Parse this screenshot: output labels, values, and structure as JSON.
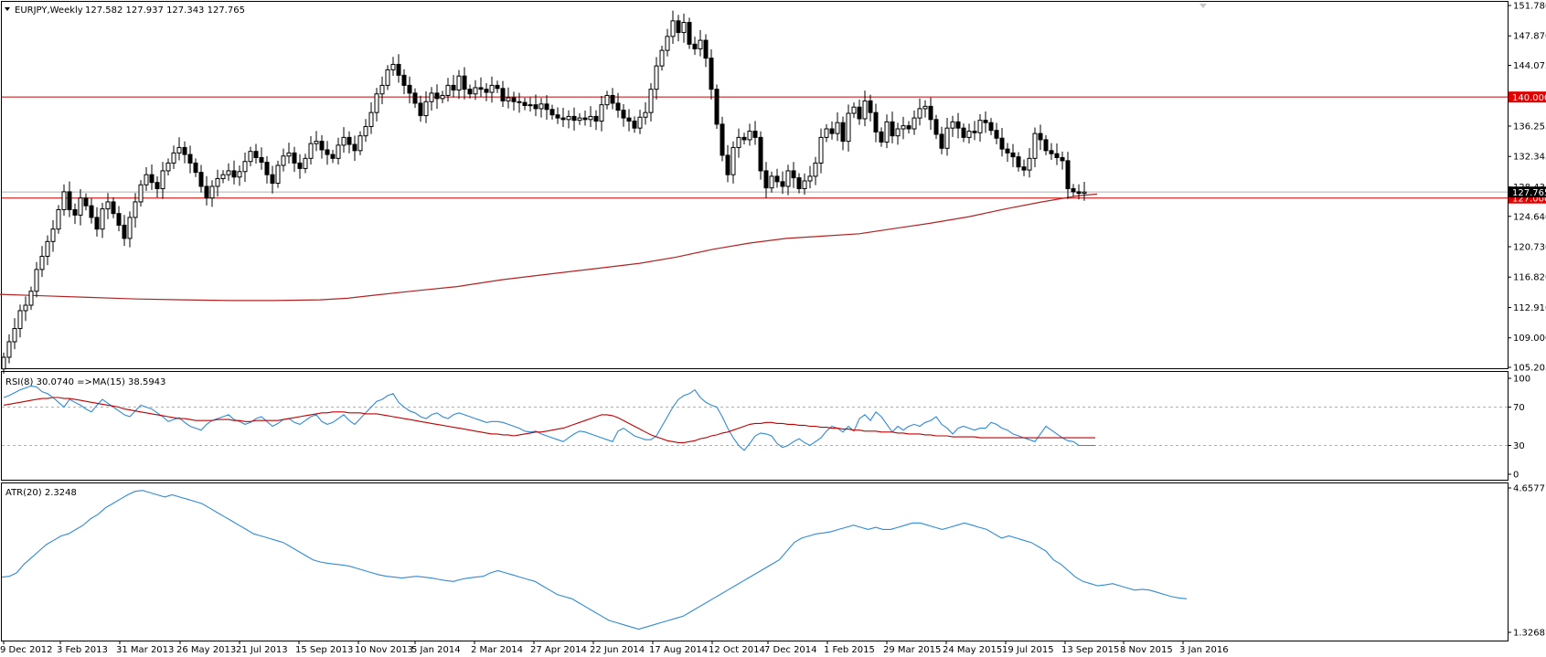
{
  "header": {
    "symbol": "EURJPY,Weekly",
    "ohlc": "127.582 127.937 127.343 127.765",
    "rsi_label": "RSI(8) 30.0740  =>MA(15) 38.5943",
    "atr_label": "ATR(20) 2.3248"
  },
  "colors": {
    "candle_up": "#ffffff",
    "candle_down": "#000000",
    "hline": "#cc0000",
    "ma": "#b22222",
    "rsi": "#2f8ad8",
    "rsi_ma": "#c00000",
    "atr": "#2f8ad8",
    "tag_bg": "#e00000",
    "grid": "#b0b0b0"
  },
  "chart_data": [
    {
      "type": "candlestick",
      "title": "EURJPY,Weekly",
      "x_labels": [
        "9 Dec 2012",
        "3 Feb 2013",
        "31 Mar 2013",
        "26 May 2013",
        "21 Jul 2013",
        "15 Sep 2013",
        "10 Nov 2013",
        "5 Jan 2014",
        "2 Mar 2014",
        "27 Apr 2014",
        "22 Jun 2014",
        "17 Aug 2014",
        "12 Oct 2014",
        "7 Dec 2014",
        "1 Feb 2015",
        "29 Mar 2015",
        "24 May 2015",
        "19 Jul 2015",
        "13 Sep 2015",
        "8 Nov 2015",
        "3 Jan 2016"
      ],
      "y_ticks": [
        "151.780",
        "147.870",
        "144.075",
        "140.000",
        "136.255",
        "132.345",
        "128.435",
        "124.640",
        "120.730",
        "116.820",
        "112.910",
        "109.000",
        "105.205"
      ],
      "ylim": [
        105.205,
        151.78
      ],
      "price_tag": "127.765",
      "horizontal_lines": [
        {
          "value": 140.0,
          "label": "140.000"
        },
        {
          "value": 127.0,
          "label": "127.000"
        }
      ],
      "closes": [
        106.5,
        108.5,
        110.2,
        112.5,
        113.2,
        115.0,
        117.8,
        119.5,
        121.4,
        123.0,
        125.5,
        127.8,
        125.5,
        124.8,
        127.0,
        126.0,
        124.5,
        123.0,
        125.6,
        126.5,
        125.0,
        123.5,
        121.8,
        124.5,
        126.5,
        128.7,
        130.0,
        129.0,
        128.2,
        130.5,
        131.5,
        132.8,
        133.5,
        132.6,
        131.5,
        130.3,
        128.5,
        127.0,
        128.5,
        129.5,
        130.0,
        130.5,
        129.7,
        130.4,
        131.7,
        133.0,
        132.2,
        131.6,
        130.0,
        128.9,
        131.2,
        132.4,
        132.8,
        131.5,
        130.8,
        132.1,
        134.0,
        134.3,
        133.2,
        132.6,
        132.1,
        133.8,
        134.8,
        133.9,
        133.1,
        135.0,
        136.2,
        138.0,
        140.4,
        141.5,
        143.5,
        144.2,
        142.8,
        141.5,
        140.5,
        139.2,
        137.6,
        139.4,
        140.5,
        139.8,
        140.2,
        141.5,
        140.9,
        142.7,
        141.0,
        140.4,
        141.2,
        141.0,
        140.6,
        141.5,
        141.1,
        139.5,
        139.9,
        139.4,
        139.3,
        138.9,
        139.0,
        138.5,
        139.1,
        138.4,
        137.7,
        137.3,
        137.1,
        137.5,
        137.0,
        137.3,
        137.1,
        137.5,
        136.9,
        139.0,
        140.2,
        139.2,
        138.3,
        137.3,
        136.9,
        136.0,
        137.4,
        138.0,
        141.0,
        144.0,
        146.0,
        147.8,
        149.8,
        148.3,
        149.6,
        146.8,
        146.2,
        147.3,
        145.0,
        141.0,
        136.5,
        132.5,
        130.0,
        133.5,
        134.8,
        134.5,
        135.6,
        134.8,
        130.5,
        128.3,
        129.8,
        129.1,
        128.5,
        130.5,
        129.6,
        128.2,
        129.2,
        129.8,
        131.5,
        134.8,
        135.9,
        135.3,
        136.7,
        134.3,
        137.9,
        138.7,
        137.2,
        139.5,
        138.0,
        135.5,
        134.2,
        136.8,
        135.0,
        135.9,
        136.3,
        135.9,
        137.3,
        138.5,
        138.8,
        137.1,
        135.2,
        133.4,
        136.0,
        136.8,
        136.0,
        134.8,
        135.6,
        135.4,
        137.0,
        136.7,
        135.7,
        134.7,
        133.3,
        132.8,
        132.3,
        131.0,
        130.6,
        132.1,
        135.3,
        134.5,
        133.1,
        132.7,
        132.2,
        131.8,
        128.2,
        127.8,
        127.6,
        127.765
      ],
      "ma_line": [
        [
          0,
          114.6
        ],
        [
          50,
          114.4
        ],
        [
          100,
          114.2
        ],
        [
          150,
          114.0
        ],
        [
          200,
          113.9
        ],
        [
          250,
          113.8
        ],
        [
          300,
          113.8
        ],
        [
          350,
          113.9
        ],
        [
          380,
          114.1
        ],
        [
          410,
          114.5
        ],
        [
          450,
          115.0
        ],
        [
          500,
          115.6
        ],
        [
          550,
          116.5
        ],
        [
          600,
          117.2
        ],
        [
          650,
          117.9
        ],
        [
          700,
          118.6
        ],
        [
          740,
          119.4
        ],
        [
          780,
          120.4
        ],
        [
          820,
          121.2
        ],
        [
          860,
          121.8
        ],
        [
          900,
          122.1
        ],
        [
          940,
          122.4
        ],
        [
          980,
          123.1
        ],
        [
          1020,
          123.8
        ],
        [
          1060,
          124.6
        ],
        [
          1100,
          125.6
        ],
        [
          1140,
          126.5
        ],
        [
          1180,
          127.3
        ],
        [
          1200,
          127.5
        ]
      ],
      "x_unit": "pixel x offset of MA sample is layout; values listed only as price"
    },
    {
      "type": "line",
      "title": "RSI(8) 30.0740  =>MA(15) 38.5943",
      "y_ticks": [
        "100",
        "70",
        "30",
        "0"
      ],
      "ylim": [
        0,
        100
      ],
      "levels": [
        70,
        30
      ],
      "series": [
        {
          "name": "RSI(8)",
          "values": [
            80,
            82,
            85,
            88,
            90,
            92,
            91,
            86,
            84,
            80,
            75,
            70,
            78,
            75,
            72,
            68,
            65,
            72,
            78,
            74,
            70,
            66,
            62,
            60,
            66,
            72,
            70,
            68,
            64,
            60,
            55,
            57,
            59,
            54,
            50,
            48,
            46,
            52,
            56,
            58,
            60,
            62,
            57,
            55,
            52,
            54,
            58,
            60,
            55,
            50,
            53,
            57,
            58,
            54,
            52,
            56,
            60,
            62,
            55,
            52,
            54,
            58,
            62,
            56,
            52,
            58,
            64,
            70,
            76,
            78,
            82,
            84,
            75,
            70,
            66,
            64,
            60,
            58,
            62,
            64,
            60,
            58,
            62,
            64,
            62,
            60,
            58,
            56,
            54,
            55,
            55,
            54,
            52,
            50,
            48,
            45,
            44,
            45,
            42,
            40,
            38,
            36,
            34,
            38,
            42,
            45,
            44,
            42,
            40,
            38,
            36,
            34,
            45,
            48,
            44,
            40,
            38,
            36,
            36,
            40,
            50,
            60,
            70,
            78,
            82,
            84,
            88,
            80,
            75,
            72,
            70,
            60,
            48,
            38,
            30,
            25,
            32,
            40,
            43,
            42,
            40,
            32,
            28,
            30,
            34,
            37,
            33,
            30,
            34,
            38,
            45,
            50,
            48,
            44,
            50,
            45,
            58,
            62,
            56,
            65,
            60,
            52,
            44,
            50,
            46,
            50,
            52,
            50,
            54,
            56,
            60,
            52,
            48,
            42,
            48,
            50,
            48,
            46,
            48,
            48,
            54,
            52,
            48,
            46,
            42,
            40,
            38,
            36,
            34,
            42,
            50,
            46,
            42,
            38,
            35,
            34,
            30,
            30,
            30,
            30
          ]
        },
        {
          "name": "MA(15)",
          "values": [
            72,
            73,
            74,
            75,
            76,
            77,
            78,
            79,
            79,
            80,
            80,
            79,
            79,
            78,
            77,
            76,
            75,
            74,
            73,
            72,
            71,
            70,
            68,
            67,
            66,
            65,
            64,
            63,
            62,
            61,
            60,
            59,
            58,
            58,
            57,
            56,
            56,
            56,
            56,
            57,
            57,
            57,
            56,
            56,
            55,
            55,
            56,
            56,
            56,
            56,
            56,
            57,
            58,
            59,
            60,
            61,
            62,
            63,
            64,
            64,
            65,
            65,
            65,
            64,
            64,
            64,
            63,
            63,
            63,
            62,
            61,
            60,
            59,
            58,
            57,
            56,
            55,
            54,
            53,
            52,
            51,
            50,
            49,
            48,
            47,
            46,
            45,
            44,
            43,
            42,
            42,
            41,
            41,
            40,
            41,
            42,
            43,
            44,
            44,
            45,
            46,
            47,
            48,
            50,
            52,
            54,
            56,
            58,
            60,
            62,
            62,
            61,
            59,
            56,
            53,
            50,
            47,
            44,
            41,
            39,
            37,
            35,
            34,
            33,
            33,
            34,
            35,
            37,
            38,
            40,
            41,
            43,
            44,
            46,
            48,
            50,
            52,
            53,
            53,
            54,
            54,
            53,
            53,
            52,
            52,
            51,
            51,
            50,
            50,
            49,
            49,
            48,
            48,
            47,
            47,
            46,
            46,
            45,
            45,
            45,
            44,
            44,
            44,
            43,
            43,
            42,
            42,
            42,
            41,
            41,
            40,
            40,
            40,
            39,
            39,
            39,
            39,
            39,
            38,
            38,
            38,
            38,
            38,
            38,
            38,
            38,
            38,
            38,
            38,
            38,
            38,
            38,
            38,
            38,
            38,
            38,
            38,
            38,
            38,
            38
          ]
        }
      ]
    },
    {
      "type": "line",
      "title": "ATR(20) 2.3248",
      "y_ticks": [
        "4.6577",
        "1.3268"
      ],
      "ylim": [
        1.3268,
        4.6577
      ],
      "series": [
        {
          "name": "ATR(20)",
          "values": [
            2.6,
            2.62,
            2.7,
            2.9,
            3.05,
            3.2,
            3.35,
            3.45,
            3.55,
            3.6,
            3.7,
            3.8,
            3.95,
            4.05,
            4.2,
            4.3,
            4.4,
            4.5,
            4.58,
            4.6,
            4.55,
            4.5,
            4.45,
            4.5,
            4.45,
            4.4,
            4.35,
            4.3,
            4.2,
            4.1,
            4.0,
            3.9,
            3.8,
            3.7,
            3.6,
            3.55,
            3.5,
            3.45,
            3.4,
            3.3,
            3.2,
            3.1,
            3.0,
            2.95,
            2.92,
            2.9,
            2.88,
            2.85,
            2.8,
            2.75,
            2.7,
            2.65,
            2.62,
            2.6,
            2.58,
            2.6,
            2.62,
            2.6,
            2.58,
            2.55,
            2.52,
            2.5,
            2.55,
            2.58,
            2.6,
            2.62,
            2.7,
            2.75,
            2.7,
            2.65,
            2.6,
            2.55,
            2.5,
            2.4,
            2.3,
            2.2,
            2.15,
            2.1,
            2.0,
            1.9,
            1.8,
            1.7,
            1.6,
            1.55,
            1.5,
            1.45,
            1.4,
            1.45,
            1.5,
            1.55,
            1.6,
            1.65,
            1.7,
            1.8,
            1.9,
            2.0,
            2.1,
            2.2,
            2.3,
            2.4,
            2.5,
            2.6,
            2.7,
            2.8,
            2.9,
            3.0,
            3.2,
            3.4,
            3.5,
            3.55,
            3.6,
            3.62,
            3.65,
            3.7,
            3.75,
            3.8,
            3.75,
            3.7,
            3.75,
            3.7,
            3.7,
            3.75,
            3.8,
            3.85,
            3.85,
            3.8,
            3.75,
            3.7,
            3.75,
            3.8,
            3.85,
            3.8,
            3.75,
            3.7,
            3.6,
            3.5,
            3.55,
            3.5,
            3.45,
            3.4,
            3.3,
            3.2,
            3.0,
            2.9,
            2.75,
            2.6,
            2.5,
            2.45,
            2.4,
            2.42,
            2.45,
            2.4,
            2.35,
            2.3,
            2.32,
            2.3,
            2.25,
            2.2,
            2.15,
            2.12,
            2.1
          ]
        }
      ]
    }
  ]
}
